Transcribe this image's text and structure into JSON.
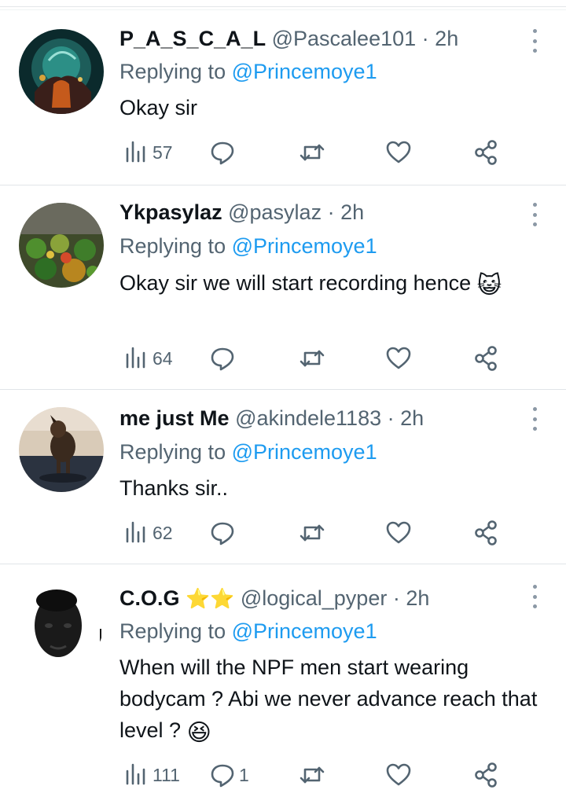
{
  "colors": {
    "accent": "#1d9bf0",
    "secondary_text": "#536471",
    "primary_text": "#0f1419",
    "divider": "#e1e5e8"
  },
  "tweets": [
    {
      "name": "P_A_S_C_A_L",
      "handle": "@Pascalee101",
      "separator": "·",
      "time": "2h",
      "replying_prefix": "Replying to",
      "replying_to": "@Princemoye1",
      "text": "Okay sir",
      "emoji": "",
      "views": "57",
      "replies": "",
      "avatar_icon": "fantasy-landscape-avatar"
    },
    {
      "name": "Ykpasylaz",
      "handle": "@pasylaz",
      "separator": "·",
      "time": "2h",
      "replying_prefix": "Replying to",
      "replying_to": "@Princemoye1",
      "text": "Okay sir we will start recording hence",
      "emoji": "😺",
      "views": "64",
      "replies": "",
      "avatar_icon": "market-produce-avatar"
    },
    {
      "name": "me just Me",
      "handle": "@akindele1183",
      "separator": "·",
      "time": "2h",
      "replying_prefix": "Replying to",
      "replying_to": "@Princemoye1",
      "text": "Thanks sir..",
      "emoji": "",
      "views": "62",
      "replies": "",
      "avatar_icon": "dog-avatar"
    },
    {
      "name": "C.O.G",
      "badge": "⭐⭐",
      "handle": "@logical_pyper",
      "separator": "·",
      "time": "2h",
      "replying_prefix": "Replying to",
      "replying_to": "@Princemoye1",
      "text": "When will the NPF men start wearing bodycam ? Abi we never advance reach that level ?",
      "emoji": "😆",
      "views": "111",
      "replies": "1",
      "avatar_icon": "portrait-avatar"
    }
  ]
}
